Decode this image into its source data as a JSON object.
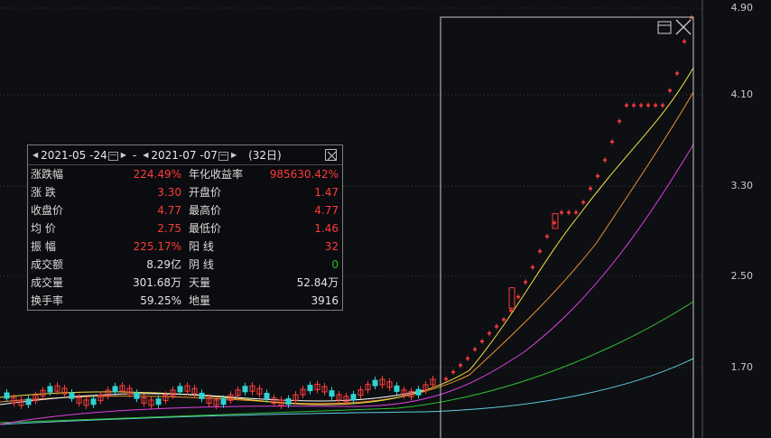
{
  "price_axis": {
    "ticks": [
      "4.90",
      "4.10",
      "3.30",
      "2.50",
      "1.70"
    ]
  },
  "colors": {
    "up": "#ff3b3b",
    "down": "#2fd3d3",
    "ma5": "#ffffff",
    "ma10": "#f0e040",
    "ma20": "#f09030",
    "ma30": "#e040e0",
    "ma60": "#30c030",
    "ma120": "#60d0e0"
  },
  "selection_box": {
    "close_icon": "close-x-icon",
    "restore_icon": "window-restore-icon"
  },
  "stats_panel": {
    "start_date": "2021-05 -24",
    "end_date": "2021-07 -07",
    "dash": "-",
    "days": "(32日)",
    "rows": [
      {
        "label_left": "涨跌幅",
        "value_left": "224.49%",
        "label_right": "年化收益率",
        "value_right": "985630.42%"
      },
      {
        "label_left": "涨  跌",
        "value_left": "3.30",
        "label_right": "开盘价",
        "value_right": "1.47"
      },
      {
        "label_left": "收盘价",
        "value_left": "4.77",
        "label_right": "最高价",
        "value_right": "4.77"
      },
      {
        "label_left": "均  价",
        "value_left": "2.75",
        "label_right": "最低价",
        "value_right": "1.46"
      },
      {
        "label_left": "振  幅",
        "value_left": "225.17%",
        "label_right": "阳  线",
        "value_right": "32"
      },
      {
        "label_left": "成交额",
        "value_left": "8.29亿",
        "label_right": "阴  线",
        "value_right": "0"
      },
      {
        "label_left": "成交量",
        "value_left": "301.68万",
        "label_right": "天量",
        "value_right": "52.84万"
      },
      {
        "label_left": "换手率",
        "value_left": "59.25%",
        "label_right": "地量",
        "value_right": "3916"
      }
    ]
  }
}
